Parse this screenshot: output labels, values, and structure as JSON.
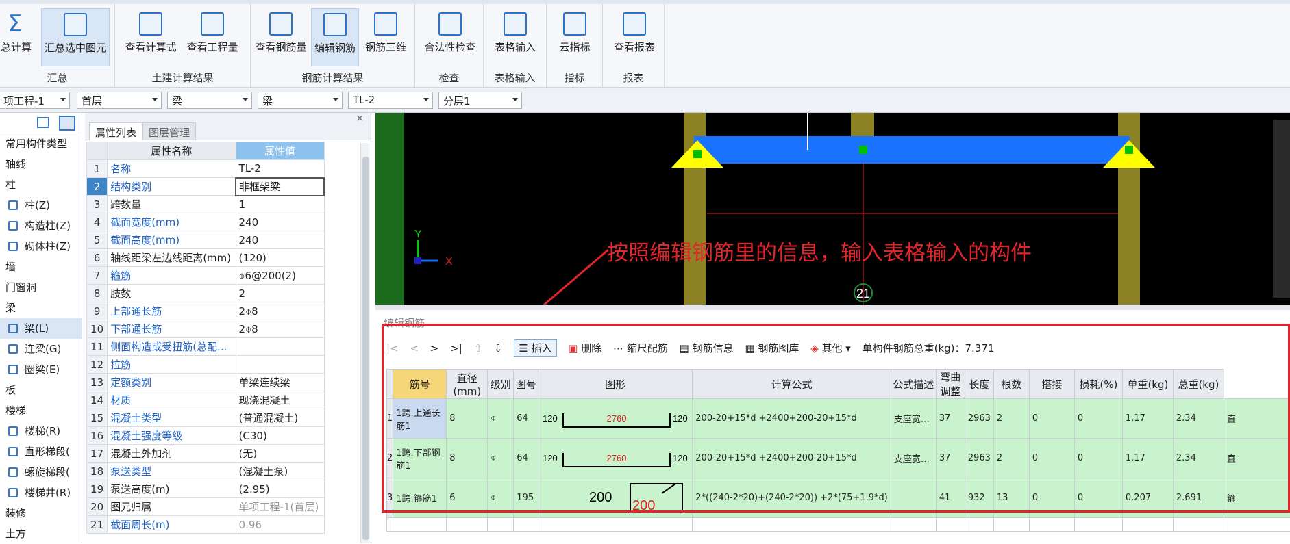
{
  "ribbon": {
    "groups": [
      {
        "label": "汇总",
        "buttons": [
          "汇总计算",
          "汇总选中图元"
        ]
      },
      {
        "label": "土建计算结果",
        "buttons": [
          "查看计算式",
          "查看工程量"
        ]
      },
      {
        "label": "钢筋计算结果",
        "buttons": [
          "查看钢筋量",
          "编辑钢筋",
          "钢筋三维"
        ]
      },
      {
        "label": "检查",
        "buttons": [
          "合法性检查"
        ]
      },
      {
        "label": "表格输入",
        "buttons": [
          "表格输入"
        ]
      },
      {
        "label": "指标",
        "buttons": [
          "云指标"
        ]
      },
      {
        "label": "报表",
        "buttons": [
          "查看报表"
        ]
      }
    ],
    "partial_left": "汇总计算"
  },
  "combos": [
    "项工程-1",
    "首层",
    "梁",
    "梁",
    "TL-2",
    "分层1"
  ],
  "tree": [
    {
      "label": "常用构件类型",
      "sub": false
    },
    {
      "label": "轴线",
      "sub": false
    },
    {
      "label": "柱",
      "sub": false
    },
    {
      "label": "柱(Z)",
      "sub": true
    },
    {
      "label": "构造柱(Z)",
      "sub": true
    },
    {
      "label": "砌体柱(Z)",
      "sub": true
    },
    {
      "label": "墙",
      "sub": false
    },
    {
      "label": "门窗洞",
      "sub": false
    },
    {
      "label": "梁",
      "sub": false
    },
    {
      "label": "梁(L)",
      "sub": true,
      "selected": true
    },
    {
      "label": "连梁(G)",
      "sub": true
    },
    {
      "label": "圈梁(E)",
      "sub": true
    },
    {
      "label": "板",
      "sub": false
    },
    {
      "label": "楼梯",
      "sub": false
    },
    {
      "label": "楼梯(R)",
      "sub": true
    },
    {
      "label": "直形梯段(",
      "sub": true
    },
    {
      "label": "螺旋梯段(",
      "sub": true
    },
    {
      "label": "楼梯井(R)",
      "sub": true
    },
    {
      "label": "装修",
      "sub": false
    },
    {
      "label": "土方",
      "sub": false
    }
  ],
  "props": {
    "tabs": [
      "属性列表",
      "图层管理"
    ],
    "header": {
      "name": "属性名称",
      "value": "属性值"
    },
    "rows": [
      {
        "n": "1",
        "k": "名称",
        "v": "TL-2",
        "blue": true
      },
      {
        "n": "2",
        "k": "结构类别",
        "v": "非框架梁",
        "blue": true,
        "sel": true
      },
      {
        "n": "3",
        "k": "跨数量",
        "v": "1"
      },
      {
        "n": "4",
        "k": "截面宽度(mm)",
        "v": "240",
        "blue": true
      },
      {
        "n": "5",
        "k": "截面高度(mm)",
        "v": "240",
        "blue": true
      },
      {
        "n": "6",
        "k": "轴线距梁左边线距离(mm)",
        "v": "(120)"
      },
      {
        "n": "7",
        "k": "箍筋",
        "v": "⌽6@200(2)",
        "blue": true
      },
      {
        "n": "8",
        "k": "肢数",
        "v": "2"
      },
      {
        "n": "9",
        "k": "上部通长筋",
        "v": "2⌽8",
        "blue": true
      },
      {
        "n": "10",
        "k": "下部通长筋",
        "v": "2⌽8",
        "blue": true
      },
      {
        "n": "11",
        "k": "侧面构造或受扭筋(总配...",
        "v": "",
        "blue": true
      },
      {
        "n": "12",
        "k": "拉筋",
        "v": "",
        "blue": true
      },
      {
        "n": "13",
        "k": "定额类别",
        "v": "单梁连续梁",
        "blue": true
      },
      {
        "n": "14",
        "k": "材质",
        "v": "现浇混凝土",
        "blue": true
      },
      {
        "n": "15",
        "k": "混凝土类型",
        "v": "(普通混凝土)",
        "blue": true
      },
      {
        "n": "16",
        "k": "混凝土强度等级",
        "v": "(C30)",
        "blue": true
      },
      {
        "n": "17",
        "k": "混凝土外加剂",
        "v": "(无)"
      },
      {
        "n": "18",
        "k": "泵送类型",
        "v": "(混凝土泵)",
        "blue": true
      },
      {
        "n": "19",
        "k": "泵送高度(m)",
        "v": "(2.95)"
      },
      {
        "n": "20",
        "k": "图元归属",
        "v": "单项工程-1(首层)",
        "grey": true
      },
      {
        "n": "21",
        "k": "截面周长(m)",
        "v": "0.96",
        "blue": true,
        "grey": true
      }
    ]
  },
  "viewport": {
    "axis_label": "21",
    "y_label": "Y",
    "x_label": "X"
  },
  "rebar": {
    "title": "编辑钢筋",
    "toolbar": {
      "nav": [
        "|<",
        "<",
        ">",
        ">|"
      ],
      "insert": "插入",
      "delete": "删除",
      "scale": "缩尺配筋",
      "info": "钢筋信息",
      "library": "钢筋图库",
      "other": "其他",
      "weight": "单构件钢筋总重(kg)：7.371"
    },
    "columns": [
      "筋号",
      "直径(mm)",
      "级别",
      "图号",
      "图形",
      "计算公式",
      "公式描述",
      "弯曲调整",
      "长度",
      "根数",
      "搭接",
      "损耗(%)",
      "单重(kg)",
      "总重(kg)"
    ],
    "rows": [
      {
        "idx": "1",
        "name": "1跨.上通长筋1",
        "dia": "8",
        "grade": "⌽",
        "fig": "64",
        "shape_left": "120",
        "shape_mid": "2760",
        "shape_right": "120",
        "formula": "200-20+15*d +2400+200-20+15*d",
        "desc": "支座宽…",
        "bend": "37",
        "len": "2963",
        "count": "2",
        "lap": "0",
        "loss": "0",
        "unit": "1.17",
        "total": "2.34",
        "extra": "直"
      },
      {
        "idx": "2",
        "name": "1跨.下部钢筋1",
        "dia": "8",
        "grade": "⌽",
        "fig": "64",
        "shape_left": "120",
        "shape_mid": "2760",
        "shape_right": "120",
        "formula": "200-20+15*d +2400+200-20+15*d",
        "desc": "支座宽…",
        "bend": "37",
        "len": "2963",
        "count": "2",
        "lap": "0",
        "loss": "0",
        "unit": "1.17",
        "total": "2.34",
        "extra": "直"
      },
      {
        "idx": "3",
        "name": "1跨.箍筋1",
        "dia": "6",
        "grade": "⌽",
        "fig": "195",
        "shape_left": "200",
        "shape_mid": "200",
        "formula": "2*((240-2*20)+(240-2*20)) +2*(75+1.9*d)",
        "desc": "",
        "bend": "41",
        "len": "932",
        "count": "13",
        "lap": "0",
        "loss": "0",
        "unit": "0.207",
        "total": "2.691",
        "extra": "箍"
      }
    ]
  },
  "annotation": "按照编辑钢筋里的信息，输入表格输入的构件",
  "colors": {
    "accent": "#2c73c9",
    "annotation": "#e2252b",
    "grid_row": "#c9f3cc",
    "beam": "#1a73ff"
  }
}
